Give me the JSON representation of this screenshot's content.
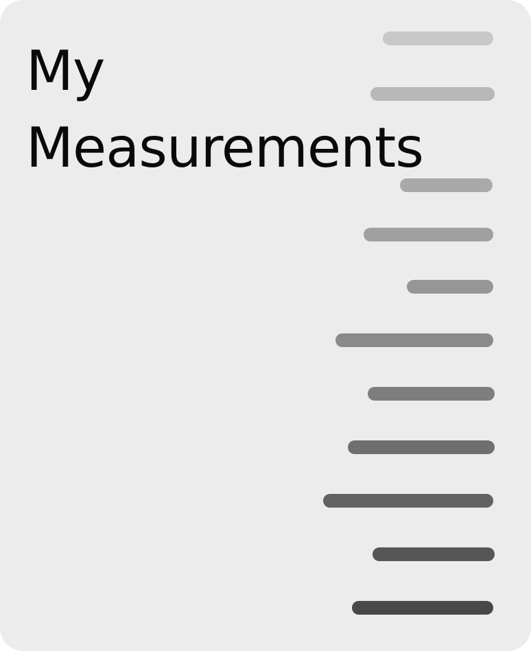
{
  "card": {
    "title_line_1": "My",
    "title_line_2": "Measurements",
    "background": "#ececec",
    "title_color": "#0a0a0a"
  },
  "bars": [
    {
      "color": "#c8c8c8"
    },
    {
      "color": "#b8b8b8"
    },
    {
      "color": "#a9a9a9"
    },
    {
      "color": "#a0a0a0"
    },
    {
      "color": "#969696"
    },
    {
      "color": "#8a8a8a"
    },
    {
      "color": "#7e7e7e"
    },
    {
      "color": "#6f6f6f"
    },
    {
      "color": "#626262"
    },
    {
      "color": "#565656"
    },
    {
      "color": "#484848"
    }
  ]
}
